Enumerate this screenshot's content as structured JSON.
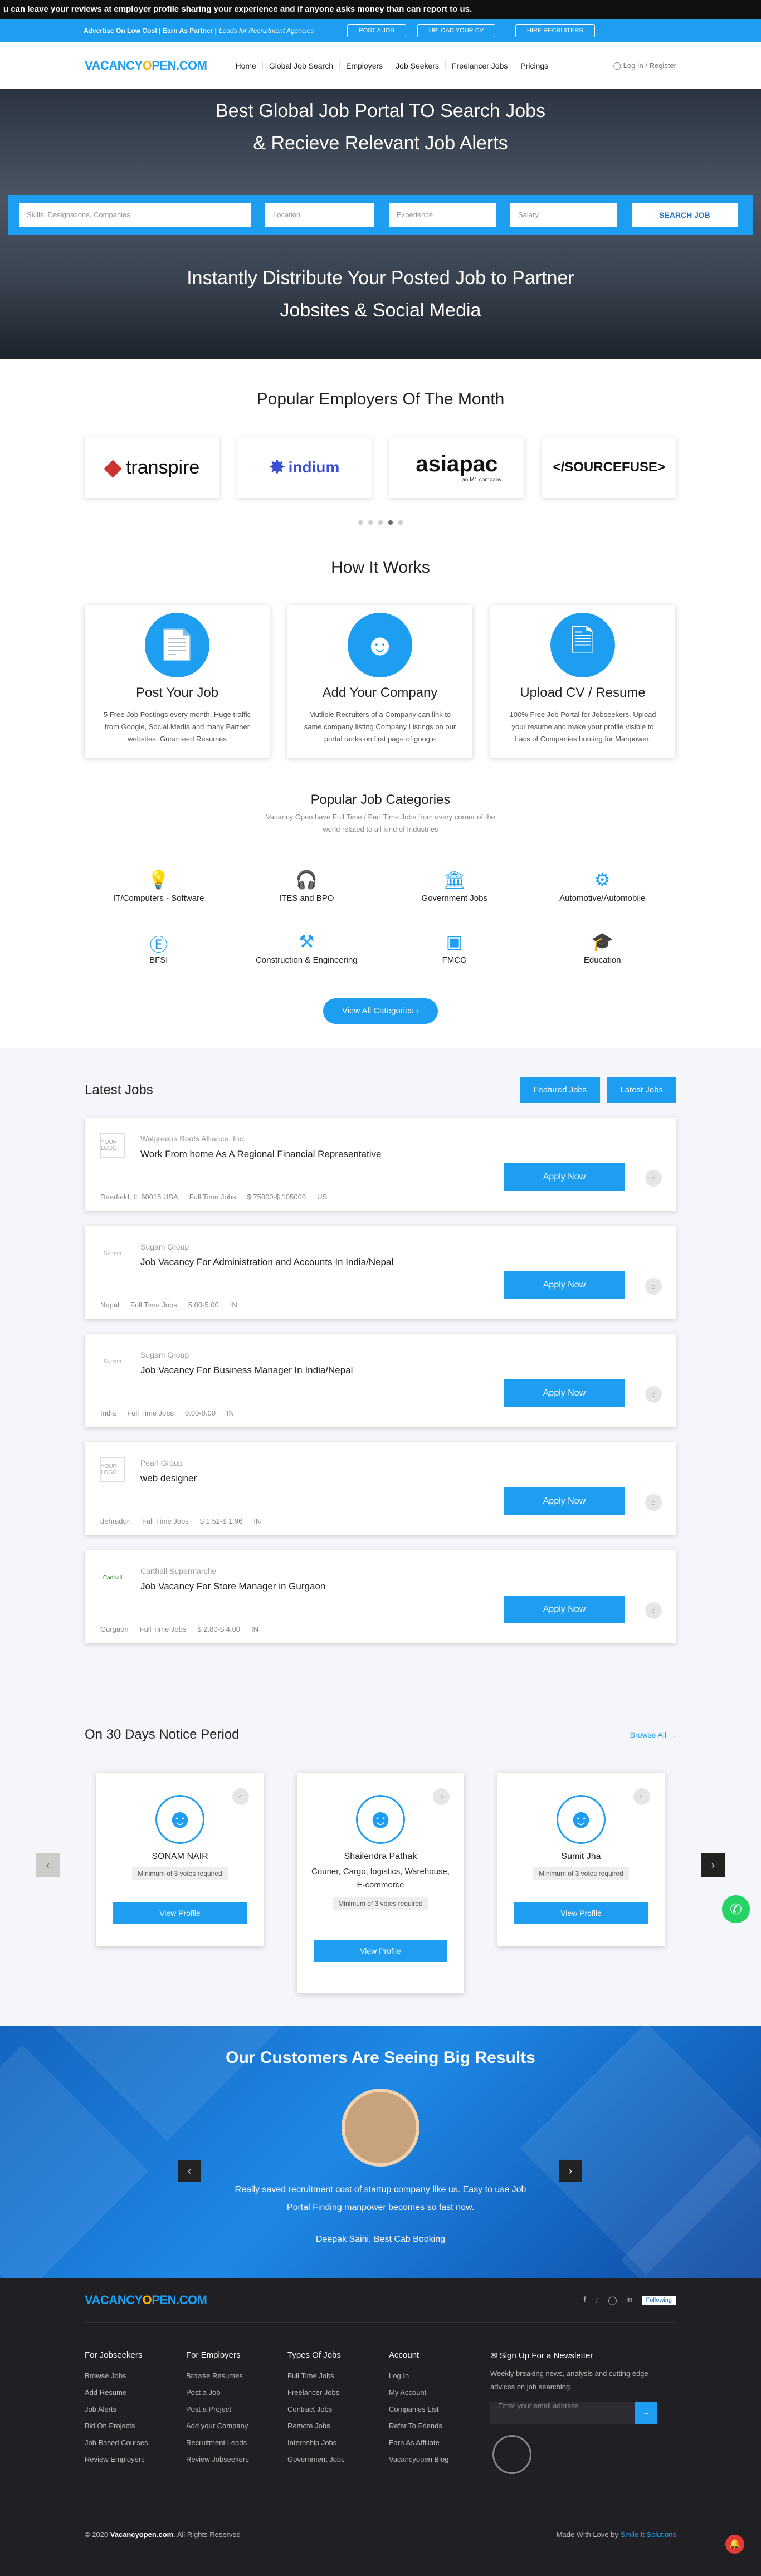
{
  "ticker": "u can leave your reviews at employer profile sharing your experience and if anyone asks money than can report to us.",
  "topbar": {
    "adv": "Advertise On Low Cost | Earn As Partner |",
    "tag": " Leads for Recruitment Agencies",
    "post": "POST A JOB",
    "upload": "UPLOAD YOUR CV",
    "hire": "HIRE RECRUITERS"
  },
  "nav": {
    "logo_a": "VACANCY",
    "logo_o": "O",
    "logo_b": "PEN.COM",
    "items": [
      "Home",
      "Global Job Search",
      "Employers",
      "Job Seekers",
      "Freelancer Jobs",
      "Pricings"
    ],
    "login": "Log In / Register"
  },
  "hero": {
    "line1": "Best Global Job Portal TO Search Jobs",
    "line2": "& Recieve Relevant Job Alerts",
    "skills": "Skills, Designations, Companies",
    "location": "Location",
    "experience": "Experience",
    "salary": "Salary",
    "search": "SEARCH JOB",
    "line3": "Instantly Distribute Your Posted Job to Partner",
    "line4": "Jobsites & Social Media"
  },
  "employers": {
    "title": "Popular Employers Of The Month",
    "logos": [
      "transpire",
      "indium",
      "asiapac",
      "</SOURCEFUSE>"
    ],
    "asiapac_sub": "an M1 company"
  },
  "how": {
    "title": "How It Works",
    "cards": [
      {
        "title": "Post Your Job",
        "text": "5 Free Job Postings every month. Huge traffic from Google, Social Media and many Partner websites. Guranteed Resumes"
      },
      {
        "title": "Add Your Company",
        "text": "Mutliple Recruiters of a Company can link to same company listing Company Listings on our portal ranks on first page of google"
      },
      {
        "title": "Upload CV / Resume",
        "text": "100% Free Job Portal for Jobseekers. Upload your resume and make your profile visible to Lacs of Companies hunting for Manpower."
      }
    ]
  },
  "cats": {
    "title": "Popular Job Categories",
    "sub1": "Vacancy Open have Full Time / Part Time Jobs from every corner of the",
    "sub2": "world related to all kind of Industries",
    "items": [
      "IT/Computers - Software",
      "ITES and BPO",
      "Government Jobs",
      "Automotive/Automobile",
      "BFSI",
      "Construction & Engineering",
      "FMCG",
      "Education"
    ],
    "button": "View All Categories"
  },
  "latest": {
    "title": "Latest Jobs",
    "featured": "Featured Jobs",
    "latest": "Latest Jobs",
    "apply": "Apply Now",
    "jobs": [
      {
        "company": "Walgreens Boots Alliance, Inc.",
        "title": "Work From home As A Regional Financial Representative",
        "loc": "Deerfield, IL 60015 USA",
        "type": "Full Time Jobs",
        "sal": "$ 75000-$ 105000",
        "cc": "US",
        "logo": "YOUR LOGO"
      },
      {
        "company": "Sugam Group",
        "title": "Job Vacancy For Administration and Accounts In India/Nepal",
        "loc": "Nepal",
        "type": "Full Time Jobs",
        "sal": "5.00-5.00",
        "cc": "IN",
        "logo": "Sugam"
      },
      {
        "company": "Sugam Group",
        "title": "Job Vacancy For Business Manager In India/Nepal",
        "loc": "India",
        "type": "Full Time Jobs",
        "sal": "0.00-0.00",
        "cc": "IN",
        "logo": "Sugam"
      },
      {
        "company": "Pearl Group",
        "title": "web designer",
        "loc": "dehradun",
        "type": "Full Time Jobs",
        "sal": "$ 1.52-$ 1.96",
        "cc": "IN",
        "logo": "YOUR LOGO"
      },
      {
        "company": "Carthall Supermarche",
        "title": "Job Vacancy For Store Manager in Gurgaon",
        "loc": "Gurgaon",
        "type": "Full Time Jobs",
        "sal": "$ 2.80-$ 4.00",
        "cc": "IN",
        "logo": "Carthall"
      }
    ]
  },
  "notice": {
    "title": "On 30 Days Notice Period",
    "browse": "Browse All",
    "view": "View Profile",
    "votes": "Minimum of 3 votes required",
    "cands": [
      {
        "name": "SONAM NAIR",
        "skill": ""
      },
      {
        "name": "Shailendra Pathak",
        "skill": "Courier, Cargo, logistics, Warehouse, E-commerce"
      },
      {
        "name": "Sumit Jha",
        "skill": ""
      }
    ]
  },
  "testi": {
    "title": "Our Customers Are Seeing Big Results",
    "quote": "Really saved recruitment cost of startup company like us. Easy to use Job Portal Finding manpower becomes so fast now.",
    "who": "Deepak Saini, Best Cab Booking"
  },
  "footer": {
    "following": "Following",
    "cols": [
      {
        "title": "For Jobseekers",
        "items": [
          "Browse Jobs",
          "Add Resume",
          "Job Alerts",
          "Bid On Projects",
          "Job Based Courses",
          "Review Employers"
        ]
      },
      {
        "title": "For Employers",
        "items": [
          "Browse Resumes",
          "Post a Job",
          "Post a Project",
          "Add your Company",
          "Recruitment Leads",
          "Review Jobseekers"
        ]
      },
      {
        "title": "Types Of Jobs",
        "items": [
          "Full Time Jobs",
          "Freelancer Jobs",
          "Contract Jobs",
          "Remote Jobs",
          "Internship Jobs",
          "Government Jobs"
        ]
      },
      {
        "title": "Account",
        "items": [
          "Log In",
          "My Account",
          "Companies List",
          "Refer To Friends",
          "Earn As Affiliate",
          "Vacancyopen Blog"
        ]
      }
    ],
    "signup": "Sign Up For a Newsletter",
    "signup_text": "Weekly breaking news, analysis and cutting edge advices on job searching.",
    "email": "Enter your email address",
    "copy_a": "© 2020",
    "copy_b": "Vacancyopen.com",
    "copy_c": ". All Rights Reserved",
    "made": "Made With Love by",
    "made_by": "Smile It Solutions"
  }
}
